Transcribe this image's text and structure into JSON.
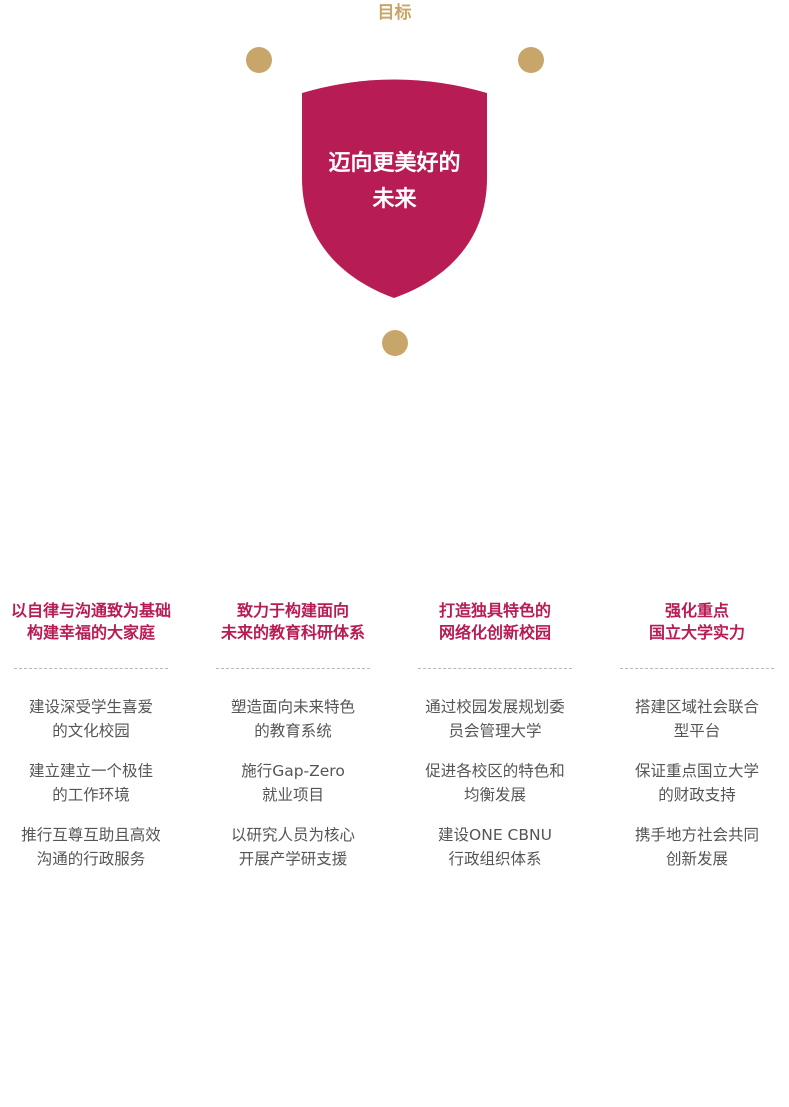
{
  "goal": {
    "label": "目标",
    "shield_lines": [
      "迈向更美好的",
      "未来"
    ]
  },
  "colors": {
    "accent_crimson": "#b81c55",
    "accent_gold": "#c8a66a",
    "body_text": "#555555",
    "divider": "#b8b8b8"
  },
  "columns": [
    {
      "title_lines": [
        "以自律与沟通致为基础",
        "构建幸福的大家庭"
      ],
      "items": [
        [
          "建设深受学生喜爱",
          "的文化校园"
        ],
        [
          "建立建立一个极佳",
          "的工作环境"
        ],
        [
          "推行互尊互助且高效",
          "沟通的行政服务"
        ]
      ]
    },
    {
      "title_lines": [
        "致力于构建面向",
        "未来的教育科研体系"
      ],
      "items": [
        [
          "塑造面向未来特色",
          "的教育系统"
        ],
        [
          "施行Gap-Zero",
          "就业项目"
        ],
        [
          "以研究人员为核心",
          "开展产学研支援"
        ]
      ]
    },
    {
      "title_lines": [
        "打造独具特色的",
        "网络化创新校园"
      ],
      "items": [
        [
          "通过校园发展规划委",
          "员会管理大学"
        ],
        [
          "促进各校区的特色和",
          "均衡发展"
        ],
        [
          "建设ONE CBNU",
          "行政组织体系"
        ]
      ]
    },
    {
      "title_lines": [
        "强化重点",
        "国立大学实力"
      ],
      "items": [
        [
          "搭建区域社会联合",
          "型平台"
        ],
        [
          "保证重点国立大学",
          "的财政支持"
        ],
        [
          "携手地方社会共同",
          "创新发展"
        ]
      ]
    }
  ]
}
